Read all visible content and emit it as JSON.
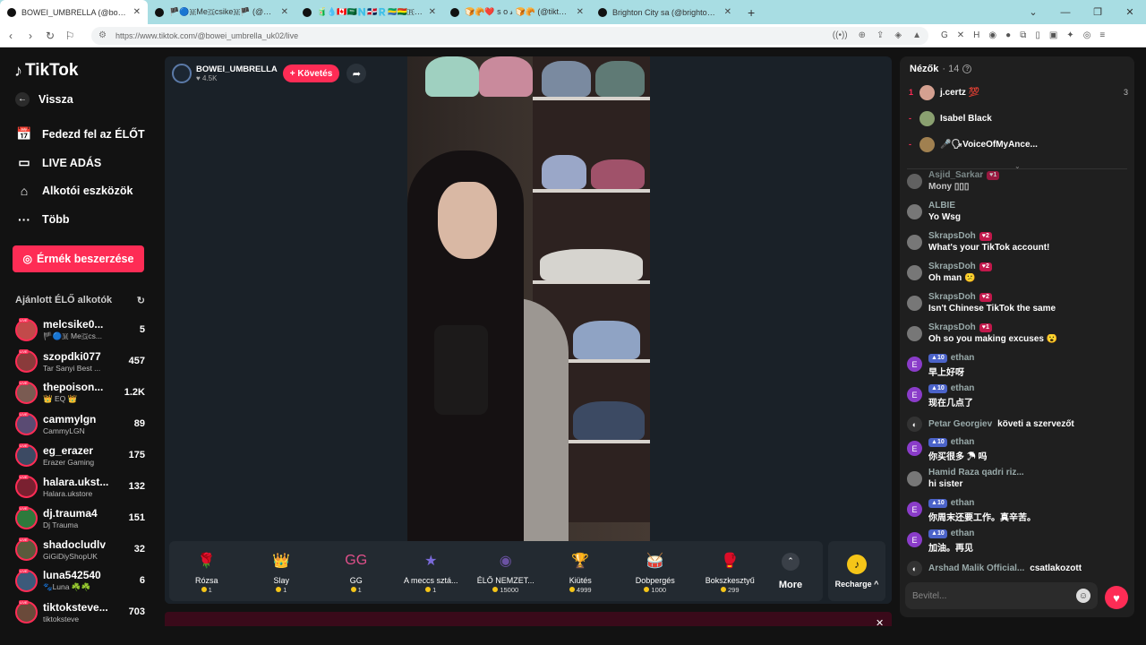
{
  "browser": {
    "tabs": [
      {
        "title": "BOWEI_UMBRELLA (@bowei",
        "active": true
      },
      {
        "title": "🏴🔵🇲Me🇬csike🇲🏴 (@melc",
        "active": false
      },
      {
        "title": "🧃💧🇨🇦🇸🇦🇳🇩🇴🇷🇬🇦🇧🇴🇷👤",
        "active": false
      },
      {
        "title": "🍞🥐❤️ s o 𝓈 🍞🥐 (@tiktok.roil",
        "active": false
      },
      {
        "title": "Brighton City sa (@brighton.city) ÉLŐ",
        "active": false
      }
    ],
    "new_tab": "+",
    "url": "https://www.tiktok.com/@bowei_umbrella_uk02/live"
  },
  "sidebar": {
    "logo": "TikTok",
    "back": "Vissza",
    "nav": [
      {
        "icon": "calendar-live-icon",
        "glyph": "📅",
        "label": "Fedezd fel az ÉLŐT"
      },
      {
        "icon": "live-camera-icon",
        "glyph": "▭",
        "label": "LIVE ADÁS"
      },
      {
        "icon": "creator-tools-icon",
        "glyph": "⌂",
        "label": "Alkotói eszközök"
      },
      {
        "icon": "more-icon",
        "glyph": "···",
        "label": "Több"
      }
    ],
    "coins_button": "Érmék beszerzése",
    "suggested_title": "Ajánlott ÉLŐ alkotók",
    "creators": [
      {
        "name": "melcsike0...",
        "sub": "🏴🔵🇲 Me🇬cs...",
        "count": "5"
      },
      {
        "name": "szopdki077",
        "sub": "Tar Sanyi Best ...",
        "count": "457"
      },
      {
        "name": "thepoison...",
        "sub": "👑 EQ 👑",
        "count": "1.2K"
      },
      {
        "name": "cammylgn",
        "sub": "CammyLGN",
        "count": "89"
      },
      {
        "name": "eg_erazer",
        "sub": "Erazer Gaming",
        "count": "175"
      },
      {
        "name": "halara.ukst...",
        "sub": "Halara.ukstore",
        "count": "132"
      },
      {
        "name": "dj.trauma4",
        "sub": "Dj Trauma",
        "count": "151"
      },
      {
        "name": "shadocludlv",
        "sub": "GiGiDiyShopUK",
        "count": "32"
      },
      {
        "name": "luna542540",
        "sub": "🐾Luna ☘️☘️",
        "count": "6"
      },
      {
        "name": "tiktoksteve...",
        "sub": "tiktoksteve",
        "count": "703"
      }
    ]
  },
  "stream": {
    "host_name": "BOWEI_UMBRELLA",
    "likes": "♥ 4.5K",
    "follow_label": "+ Követés"
  },
  "gifts": [
    {
      "name": "Rózsa",
      "price": "1",
      "glyph": "🌹"
    },
    {
      "name": "Slay",
      "price": "1",
      "glyph": "👑"
    },
    {
      "name": "GG",
      "price": "1",
      "glyph": "GG"
    },
    {
      "name": "A meccs sztá...",
      "price": "1",
      "glyph": "★"
    },
    {
      "name": "ÉLŐ NEMZET...",
      "price": "15000",
      "glyph": "◉"
    },
    {
      "name": "Kiütés",
      "price": "4999",
      "glyph": "🏆"
    },
    {
      "name": "Dobpergés",
      "price": "1000",
      "glyph": "🥁"
    },
    {
      "name": "Bokszkesztyű",
      "price": "299",
      "glyph": "🥊"
    }
  ],
  "more_label": "More",
  "recharge_label": "Recharge ^",
  "chat": {
    "viewers_label": "Nézők",
    "viewers_count": "· 14",
    "top_viewers": [
      {
        "rank": "1",
        "name": "j.certz 💯",
        "score": "3"
      },
      {
        "rank": "-",
        "name": "Isabel Black",
        "score": ""
      },
      {
        "rank": "-",
        "name": "🎤🗣VoiceOfMyAnce...",
        "score": ""
      }
    ],
    "messages": [
      {
        "name": "Asjid_Sarkar",
        "badge": "1",
        "text": "Mony ▯▯▯",
        "faded": true
      },
      {
        "name": "ALBIE",
        "badge": "",
        "text": "Yo Wsg"
      },
      {
        "name": "SkrapsDoh",
        "badge": "2",
        "text": "What's your TikTok account!"
      },
      {
        "name": "SkrapsDoh",
        "badge": "2",
        "text": "Oh man 😕"
      },
      {
        "name": "SkrapsDoh",
        "badge": "2",
        "text": "Isn't Chinese TikTok the same"
      },
      {
        "name": "SkrapsDoh",
        "badge": "1",
        "text": "Oh so you making excuses 😮"
      },
      {
        "name": "ethan",
        "level": "10",
        "text": "早上好呀"
      },
      {
        "name": "ethan",
        "level": "10",
        "text": "现在几点了"
      },
      {
        "name": "Petar Georgiev",
        "inline": true,
        "text": "követi a szervezőt"
      },
      {
        "name": "ethan",
        "level": "10",
        "text": "你买很多 ☂ 吗"
      },
      {
        "name": "Hamid Raza qadri riz...",
        "text": "hi sister"
      },
      {
        "name": "ethan",
        "level": "10",
        "text": "你周末还要工作。真辛苦。"
      },
      {
        "name": "ethan",
        "level": "10",
        "text": "加油。再见"
      },
      {
        "name": "Arshad Malik Official...",
        "inline": true,
        "text": "csatlakozott"
      }
    ],
    "input_placeholder": "Bevitel..."
  }
}
